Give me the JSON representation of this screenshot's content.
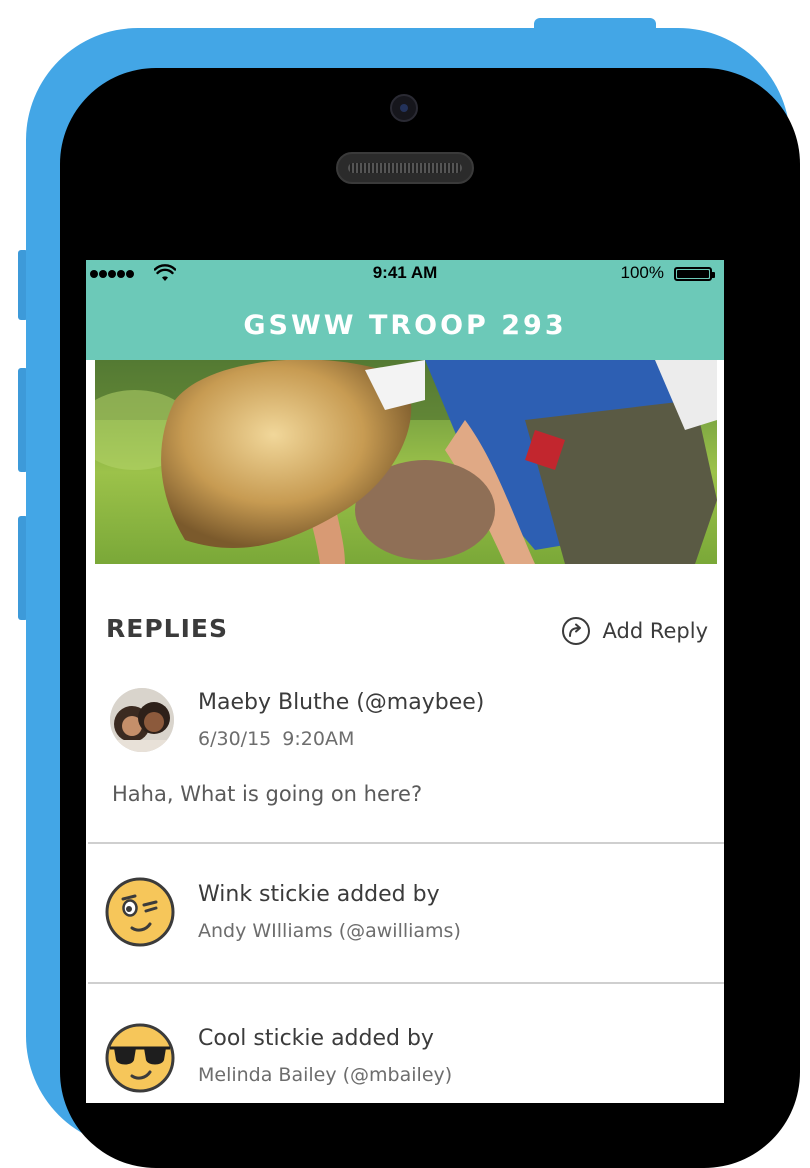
{
  "status_bar": {
    "time": "9:41 AM",
    "battery": "100%"
  },
  "nav": {
    "title": "GSWW TROOP 293"
  },
  "replies": {
    "heading": "REPLIES",
    "add_reply_label": "Add Reply",
    "add_reply_icon": "reply-arrow-icon"
  },
  "reply": {
    "author": "Maeby Bluthe (@maybee)",
    "timestamp": "6/30/15  9:20AM",
    "text": "Haha, What is going on here?"
  },
  "stickies": [
    {
      "icon": "wink-emoji-icon",
      "title": "Wink stickie added by",
      "by": "Andy WIlliams (@awilliams)"
    },
    {
      "icon": "sunglasses-emoji-icon",
      "title": "Cool stickie added by",
      "by": "Melinda Bailey (@mbailey)"
    }
  ],
  "colors": {
    "phone_shell": "#43a6e6",
    "header_teal": "#6cc9b8",
    "emoji_yellow": "#f6c65a"
  }
}
